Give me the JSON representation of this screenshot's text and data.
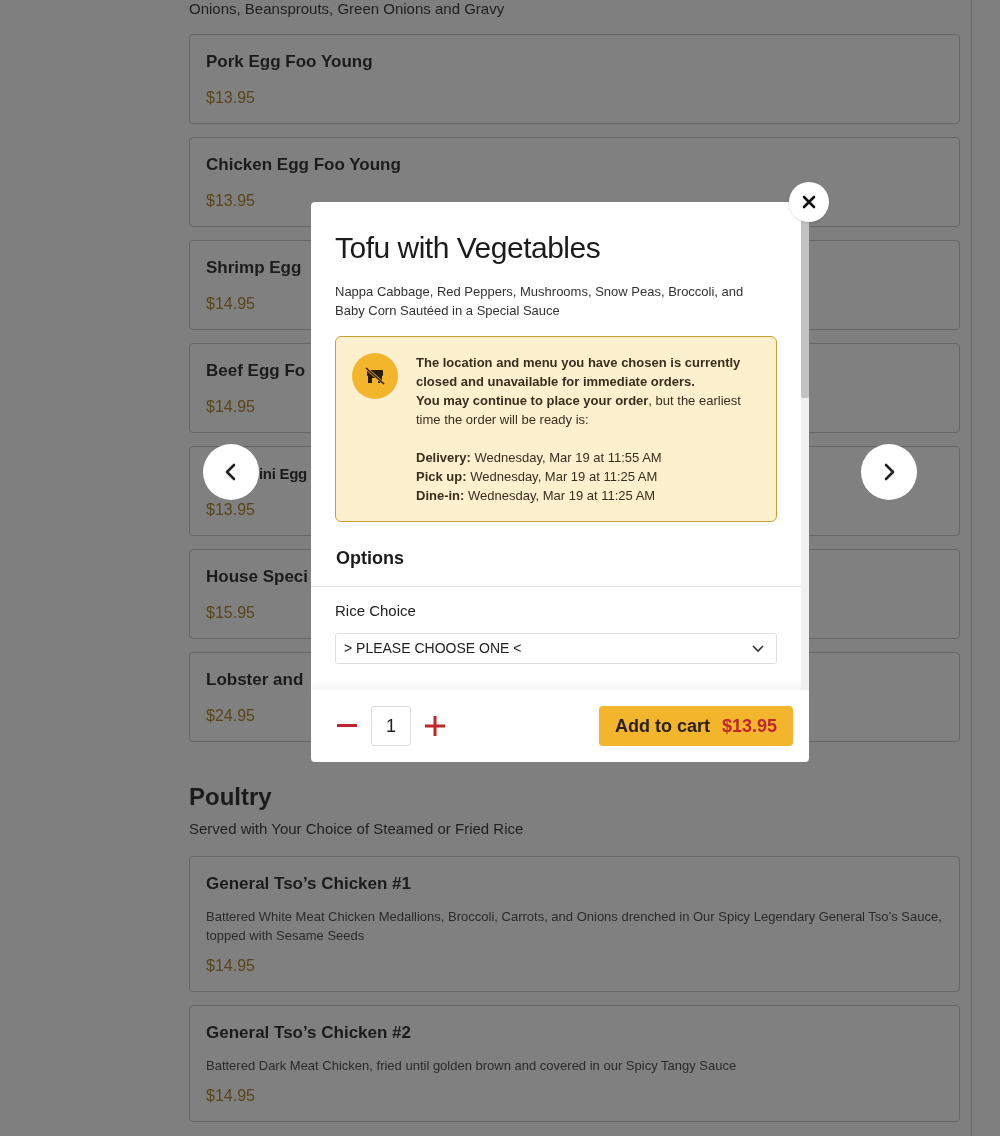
{
  "menu": {
    "intro_text": "Onions, Beansprouts, Green Onions and Gravy",
    "items": [
      {
        "name": "Pork Egg Foo Young",
        "price": "$13.95"
      },
      {
        "name": "Chicken Egg Foo Young",
        "price": "$13.95"
      },
      {
        "name": "Shrimp Egg",
        "price": "$14.95"
      },
      {
        "name": "Beef Egg Fo",
        "price": "$14.95"
      },
      {
        "name": "ini Egg",
        "price": "$13.95",
        "partly_hidden": true
      },
      {
        "name": "House Speci",
        "price": "$15.95"
      },
      {
        "name": "Lobster and",
        "price": "$24.95"
      }
    ],
    "sections": [
      {
        "title": "Poultry",
        "subtitle": "Served with Your Choice of Steamed or Fried Rice",
        "items": [
          {
            "name": "General Tso’s Chicken #1",
            "description": "Battered White Meat Chicken Medallions, Broccoli, Carrots, and Onions drenched in Our Spicy Legendary General Tso’s Sauce, topped with Sesame Seeds",
            "price": "$14.95"
          },
          {
            "name": "General Tso’s Chicken #2",
            "description": "Battered Dark Meat Chicken, fried until golden brown and covered in our Spicy Tangy Sauce",
            "price": "$14.95"
          }
        ]
      }
    ]
  },
  "modal": {
    "title": "Tofu with Vegetables",
    "description": "Nappa Cabbage, Red Peppers, Mushrooms, Snow Peas, Broccoli, and Baby Corn Sautéed in a Special Sauce",
    "notice": {
      "paragraphs": [
        "**The location and menu you have chosen is currently closed and unavailable for immediate orders.**",
        "**You may continue to place your order**, but the earliest time the order will be ready is:"
      ],
      "times": [
        "**Delivery:** Wednesday, Mar 19 at 11:55 AM",
        "**Pick up:** Wednesday, Mar 19 at 11:25 AM",
        "**Dine-in:** Wednesday, Mar 19 at 11:25 AM"
      ]
    },
    "options_heading": "Options",
    "options": [
      {
        "label": "Rice Choice",
        "placeholder": "> PLEASE CHOOSE ONE <"
      }
    ],
    "quantity": "1",
    "add_button": {
      "label": "Add to cart",
      "price": "$13.95"
    }
  }
}
